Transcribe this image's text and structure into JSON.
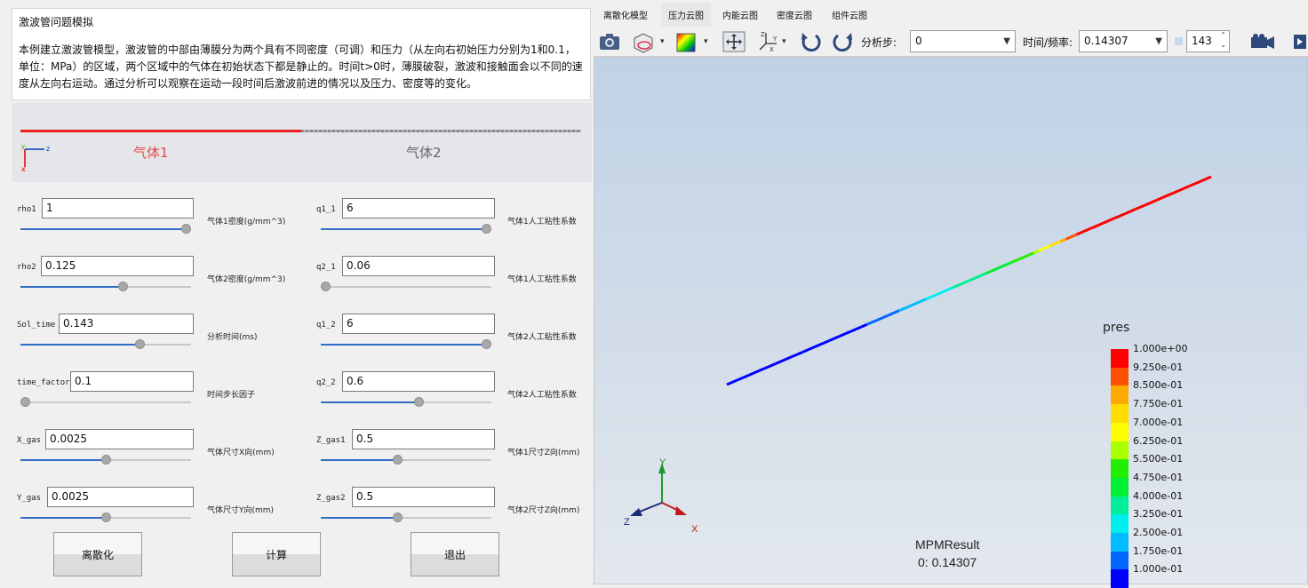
{
  "panel": {
    "title": "激波管问题模拟",
    "description": "本例建立激波管模型，激波管的中部由薄膜分为两个具有不同密度（可调）和压力（从左向右初始压力分别为1和0.1，单位：MPa）的区域，两个区域中的气体在初始状态下都是静止的。时间t>0时，薄膜破裂，激波和接触面会以不同的速度从左向右运动。通过分析可以观察在运动一段时间后激波前进的情况以及压力、密度等的变化。"
  },
  "schematic": {
    "gas1": "气体1",
    "gas2": "气体2",
    "axis_y": "y",
    "axis_z": "z",
    "axis_x": "x"
  },
  "params_left": [
    {
      "name": "rho1",
      "value": "1",
      "caption": "气体1密度(g/mm^3)",
      "slider": 1.0
    },
    {
      "name": "rho2",
      "value": "0.125",
      "caption": "气体2密度(g/mm^3)",
      "slider": 0.61
    },
    {
      "name": "Sol_time",
      "value": "0.143",
      "caption": "分析时间(ms)",
      "slider": 0.71
    },
    {
      "name": "time_factor",
      "value": "0.1",
      "caption": "时间步长因子",
      "slider": 0.0
    },
    {
      "name": "X_gas",
      "value": "0.0025",
      "caption": "气体尺寸X向(mm)",
      "slider": 0.5
    },
    {
      "name": "Y_gas",
      "value": "0.0025",
      "caption": "气体尺寸Y向(mm)",
      "slider": 0.5
    }
  ],
  "params_right": [
    {
      "name": "q1_1",
      "value": "6",
      "caption": "气体1人工粘性系数",
      "slider": 1.0
    },
    {
      "name": "q2_1",
      "value": "0.06",
      "caption": "气体1人工粘性系数",
      "slider": 0.0
    },
    {
      "name": "q1_2",
      "value": "6",
      "caption": "气体2人工粘性系数",
      "slider": 1.0
    },
    {
      "name": "q2_2",
      "value": "0.6",
      "caption": "气体2人工粘性系数",
      "slider": 0.58
    },
    {
      "name": "Z_gas1",
      "value": "0.5",
      "caption": "气体1尺寸Z向(mm)",
      "slider": 0.45
    },
    {
      "name": "Z_gas2",
      "value": "0.5",
      "caption": "气体2尺寸Z向(mm)",
      "slider": 0.45
    }
  ],
  "buttons": {
    "mesh": "离散化",
    "compute": "计算",
    "exit": "退出"
  },
  "tabs": [
    "离散化模型",
    "压力云图",
    "内能云图",
    "密度云图",
    "组件云图"
  ],
  "active_tab": 1,
  "toolbar": {
    "step_label": "分析步:",
    "step_value": "0",
    "time_label": "时间/频率:",
    "time_value": "0.14307",
    "frame_value": "143"
  },
  "legend": {
    "title": "pres",
    "values": [
      "1.000e+00",
      "9.250e-01",
      "8.500e-01",
      "7.750e-01",
      "7.000e-01",
      "6.250e-01",
      "5.500e-01",
      "4.750e-01",
      "4.000e-01",
      "3.250e-01",
      "2.500e-01",
      "1.750e-01",
      "1.000e-01"
    ],
    "colors": [
      "#ff0000",
      "#ff5000",
      "#ffaa00",
      "#ffdd00",
      "#ffff00",
      "#aaff00",
      "#22ee00",
      "#00ee33",
      "#00ee99",
      "#00eeee",
      "#00bbff",
      "#0066ff",
      "#0000ff"
    ]
  },
  "result": {
    "name": "MPMResult",
    "frame": "0: 0.14307"
  },
  "triad": {
    "x": "X",
    "y": "Y",
    "z": "Z"
  }
}
